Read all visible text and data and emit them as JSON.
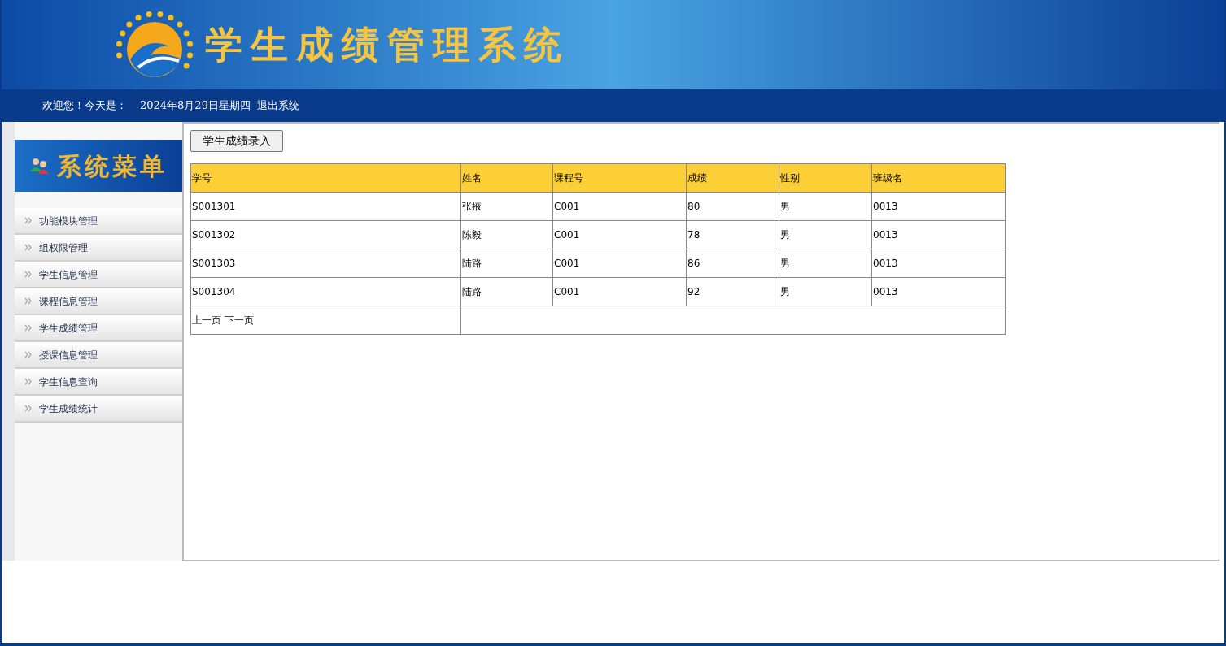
{
  "header": {
    "title": "学生成绩管理系统"
  },
  "welcome_bar": {
    "greeting": "欢迎您！今天是：",
    "date": "2024年8月29日星期四",
    "logout": "退出系统"
  },
  "sidebar": {
    "title": "系统菜单",
    "items": [
      {
        "label": "功能模块管理"
      },
      {
        "label": "组权限管理"
      },
      {
        "label": "学生信息管理"
      },
      {
        "label": "课程信息管理"
      },
      {
        "label": "学生成绩管理"
      },
      {
        "label": "授课信息管理"
      },
      {
        "label": "学生信息查询"
      },
      {
        "label": "学生成绩统计"
      }
    ]
  },
  "toolbar": {
    "button": "学生成绩录入"
  },
  "table": {
    "columns": [
      "学号",
      "姓名",
      "课程号",
      "成绩",
      "性别",
      "班级名"
    ],
    "rows": [
      [
        "S001301",
        "张掖",
        "C001",
        "80",
        "男",
        "0013"
      ],
      [
        "S001302",
        "陈毅",
        "C001",
        "78",
        "男",
        "0013"
      ],
      [
        "S001303",
        "陆路",
        "C001",
        "86",
        "男",
        "0013"
      ],
      [
        "S001304",
        "陆路",
        "C001",
        "92",
        "男",
        "0013"
      ]
    ],
    "pager": {
      "prev": "上一页",
      "next": "下一页"
    }
  }
}
